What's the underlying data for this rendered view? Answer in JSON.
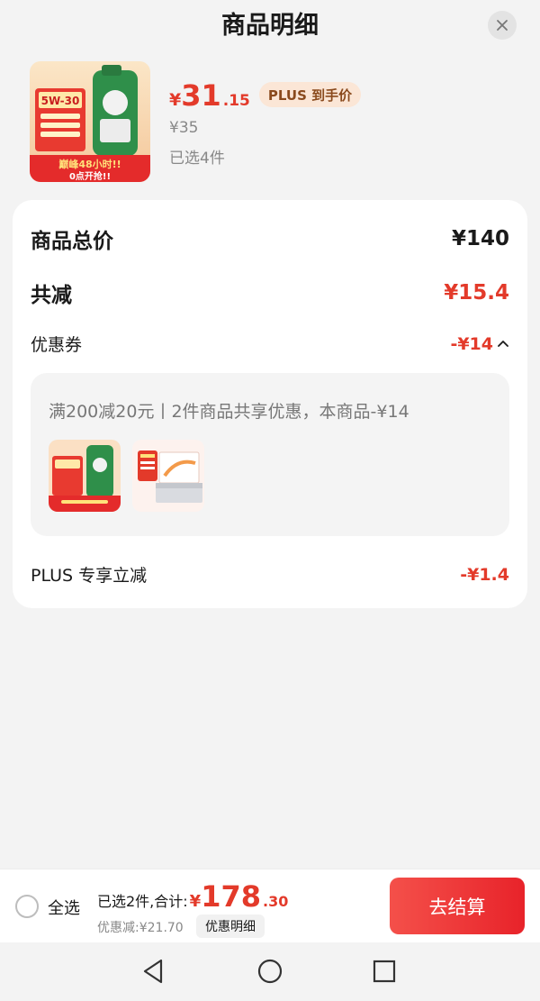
{
  "header": {
    "title": "商品明细"
  },
  "product": {
    "price_symbol": "¥",
    "price_integer": "31",
    "price_decimal": ".15",
    "plus_badge": "PLUS 到手价",
    "original_price": "¥35",
    "selected_count": "已选4件",
    "thumb_text_top": "5W-30",
    "thumb_text_promo": "巅峰48小时!!",
    "thumb_text_sub": "0点开抢!!"
  },
  "details": {
    "total_label": "商品总价",
    "total_value": "¥140",
    "reduce_label": "共减",
    "reduce_value": "¥15.4",
    "coupon_label": "优惠券",
    "coupon_value": "-¥14",
    "coupon_description": "满200减20元丨2件商品共享优惠，本商品-¥14",
    "plus_label": "PLUS 专享立减",
    "plus_value": "-¥1.4"
  },
  "bottom_bar": {
    "select_all": "全选",
    "summary_prefix": "已选2件,合计:",
    "total_symbol": "¥",
    "total_integer": "178",
    "total_decimal": ".30",
    "discount_text": "优惠减:¥21.70",
    "detail_button": "优惠明细",
    "checkout_button": "去结算"
  },
  "colors": {
    "accent_red": "#e33a2a",
    "plus_badge_bg": "#fbe6d6",
    "checkout_gradient_start": "#f4504a",
    "checkout_gradient_end": "#e8232a"
  }
}
